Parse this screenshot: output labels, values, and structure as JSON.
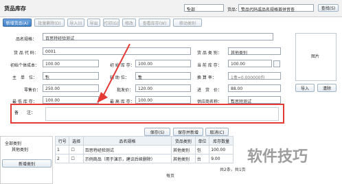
{
  "window": {
    "title": "货品库存"
  },
  "header": {
    "scope_select": "全部",
    "search_label": "货品：",
    "search_placeholder": "货品代码或品名规格首拼音查",
    "search_button": "查找(S)"
  },
  "toolbar": {
    "new": "新增货品(A)",
    "batch_delete": "批量删除(D)",
    "import": "导入(I)",
    "export": "导出",
    "print": "打印(G)",
    "price": "修改",
    "query_inventory": "查看库存(W)",
    "clear_stock": "移动类别"
  },
  "form": {
    "name_label": "品名规格：",
    "name_value": "百思特经验测试",
    "code_label": "货 品 代 码：",
    "code_value": "0001",
    "category_label": "货 品 类 别：",
    "category_value": "其他类别",
    "initial_cost_label": "初始个体成本：",
    "initial_cost_value": "100.00",
    "initial_stock_label": "初 始 库 存：",
    "initial_stock_value": "100.00",
    "current_stock_label": "当 前 库 存：",
    "current_stock_value": "100.00",
    "unit_label": "主　单　位：",
    "unit_value": "包",
    "aux_unit_label": "辅 助 位：",
    "aux_unit_value": "盒",
    "conversion_label": "换 算 率：",
    "conversion_value": "1盒=0.000000包",
    "retail_label": "零售价：",
    "retail_value": "250.00",
    "wholesale_label": "批发价：",
    "wholesale_value": "120.00",
    "purchase_label": "进　货　价：",
    "purchase_value": "88.00",
    "min_stock_label": "最 低 库 存：",
    "min_stock_value": "100.00",
    "max_stock_label": "最 高 库 存：",
    "max_stock_value": "100.00",
    "supplier_label": "供应商名称：",
    "supplier_value": "百思特测试",
    "remark_label": "备　　注："
  },
  "image_panel": {
    "label": "图片",
    "import_button": "导入",
    "clear_button": "清除"
  },
  "actions": {
    "save": "保存(S)",
    "save_new": "保存并新增",
    "cancel": "取消(C)"
  },
  "tree": {
    "root": "全部类别",
    "child": "其他类别",
    "new_button": "新增类别"
  },
  "table": {
    "headers": [
      "行号",
      "选择",
      "品名规格",
      "货品类别",
      "单位",
      "库存数量"
    ],
    "rows": [
      {
        "no": "1",
        "select": "",
        "name": "百思特经验测试",
        "category": "其他类别",
        "unit": "包",
        "stock": "100.00"
      },
      {
        "no": "2",
        "select": "",
        "name": "示例商品（用于演示，建议后续删除）",
        "category": "其他类别",
        "unit": "台",
        "stock": "9.00"
      }
    ]
  },
  "footer": {
    "summary": "共2条，共1页",
    "pager": "每页"
  },
  "watermark": {
    "text": "软件技巧"
  }
}
